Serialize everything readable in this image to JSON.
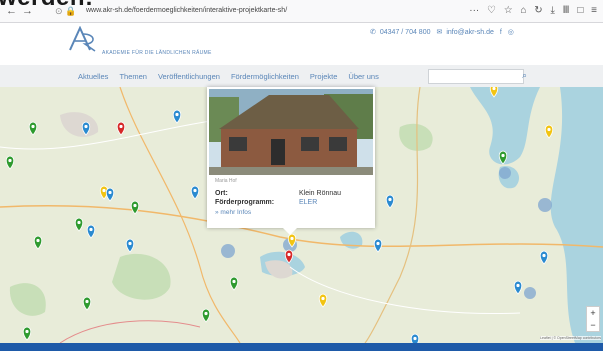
{
  "overlay_title": "werden:",
  "browser": {
    "url": "www.akr-sh.de/foerdermoeglichkeiten/interaktive-projektkarte-sh/",
    "nav_buttons": [
      "←",
      "→"
    ],
    "toolbar_icons": "··· ♡ ☆ ⌂ ↻ ⤓ Ⅲ □ ≡"
  },
  "site": {
    "logo_text": "AKADEMIE FÜR DIE LÄNDLICHEN RÄUME",
    "phone": "04347 / 704 800",
    "email": "info@akr-sh.de",
    "menu": [
      "Aktuelles",
      "Themen",
      "Veröffentlichungen",
      "Fördermöglichkeiten",
      "Projekte",
      "Über uns"
    ],
    "search_placeholder": ""
  },
  "popup": {
    "caption": "Maria Hof",
    "ort_label": "Ort:",
    "ort_value": "Klein Rönnau",
    "programm_label": "Förderprogramm:",
    "programm_value": "ELER",
    "more_link": "» mehr Infos"
  },
  "map": {
    "zoom_in": "+",
    "zoom_out": "−",
    "attribution": "Leaflet | © OpenStreetMap contributors",
    "marker_colors": {
      "green": "#2e9a2e",
      "red": "#d62828",
      "blue": "#2a8ad0",
      "yellow": "#f2c412"
    },
    "cluster_color": "#7fa6cf"
  }
}
